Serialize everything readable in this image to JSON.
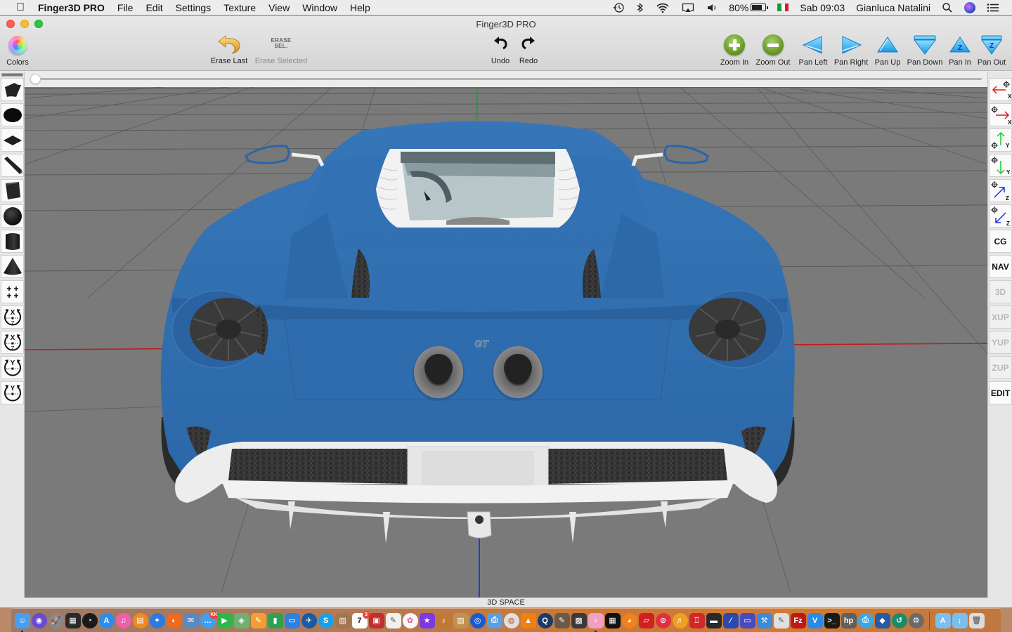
{
  "menubar": {
    "apple_icon": "apple-logo-icon",
    "app_name": "Finger3D PRO",
    "menus": [
      "File",
      "Edit",
      "Settings",
      "Texture",
      "View",
      "Window",
      "Help"
    ],
    "status": {
      "battery_percent": "80%",
      "battery_level": 0.8,
      "datetime": "Sab 09:03",
      "user": "Gianluca Natalini",
      "icons": [
        "time-machine-icon",
        "bluetooth-icon",
        "wifi-icon",
        "airplay-icon",
        "volume-icon",
        "battery-icon",
        "italian-flag-input-icon",
        "spotlight-search-icon",
        "siri-icon",
        "notification-center-icon"
      ]
    }
  },
  "window": {
    "title": "Finger3D PRO",
    "toolbar": {
      "colors": "Colors",
      "erase_last": "Erase Last",
      "erase_selected": "Erase Selected",
      "erase_sel_icon_text_1": "ERASE",
      "erase_sel_icon_text_2": "SEL.",
      "undo": "Undo",
      "redo": "Redo",
      "zoom_in": "Zoom In",
      "zoom_out": "Zoom Out",
      "pan_left": "Pan Left",
      "pan_right": "Pan Right",
      "pan_up": "Pan Up",
      "pan_down": "Pan Down",
      "pan_in": "Pan In",
      "pan_out": "Pan Out",
      "pan_in_letter": "Z",
      "pan_out_letter": "Z"
    },
    "slider_value": 0,
    "left_tools": [
      {
        "name": "curved-surface-tool",
        "icon": "curved-surface-icon"
      },
      {
        "name": "ellipse-disc-tool",
        "icon": "ellipse-icon"
      },
      {
        "name": "plane-tool",
        "icon": "plane-icon"
      },
      {
        "name": "wedge-tool",
        "icon": "wedge-icon"
      },
      {
        "name": "cube-tool",
        "icon": "cube-icon"
      },
      {
        "name": "sphere-tool",
        "icon": "sphere-icon"
      },
      {
        "name": "cylinder-tool",
        "icon": "cylinder-icon"
      },
      {
        "name": "cone-tool",
        "icon": "cone-icon"
      },
      {
        "name": "multi-add-tool",
        "icon": "plus-grid-icon"
      },
      {
        "name": "rotate-xz-cw-tool",
        "icon": "rotate-xz-icon",
        "top": "X",
        "bottom": "Z"
      },
      {
        "name": "rotate-xz-ccw-tool",
        "icon": "rotate-xz-icon",
        "top": "X",
        "bottom": "Z"
      },
      {
        "name": "rotate-y-cw-tool",
        "icon": "rotate-y-icon",
        "top": "Y",
        "bottom": ""
      },
      {
        "name": "rotate-y-ccw-tool",
        "icon": "rotate-y-icon",
        "top": "Y",
        "bottom": ""
      }
    ],
    "right_tools": {
      "move_x_neg": "X",
      "move_x_pos": "X",
      "move_y_pos": "Y",
      "move_y_neg": "Y",
      "move_z_pos": "Z",
      "move_z_neg": "Z",
      "cg": "CG",
      "nav": "NAV",
      "mode_3d": "3D",
      "xup": "XUP",
      "yup": "YUP",
      "zup": "ZUP",
      "edit": "EDIT"
    },
    "viewport": {
      "background": "#7a7a7a",
      "model_color": "#2f6fb0",
      "axis_colors": {
        "x": "#cc1f1f",
        "y": "#1fa12f",
        "z": "#1f3fcc"
      },
      "badge_text": "GT"
    },
    "status_label": "3D SPACE"
  },
  "dock": {
    "apps": [
      {
        "name": "finder",
        "color": "#4a9ef0",
        "glyph": "☺",
        "running": true
      },
      {
        "name": "siri",
        "color": "#6a4ad0",
        "glyph": "◉",
        "round": true
      },
      {
        "name": "launchpad",
        "color": "#888",
        "glyph": "🚀",
        "round": true
      },
      {
        "name": "mission-control",
        "color": "#2a2a2a",
        "glyph": "▦"
      },
      {
        "name": "dashboard",
        "color": "#1a1a1a",
        "glyph": "◔",
        "round": true
      },
      {
        "name": "app-store",
        "color": "#2a8ef0",
        "glyph": "A",
        "round": true
      },
      {
        "name": "itunes",
        "color": "#f060a8",
        "glyph": "♫",
        "round": true
      },
      {
        "name": "ibooks",
        "color": "#f08a20",
        "glyph": "▤",
        "round": true
      },
      {
        "name": "safari",
        "color": "#2a7ae0",
        "glyph": "✦",
        "round": true
      },
      {
        "name": "firefox",
        "color": "#f06a1a",
        "glyph": "◐",
        "round": true
      },
      {
        "name": "mail",
        "color": "#5a88c0",
        "glyph": "✉"
      },
      {
        "name": "messages",
        "color": "#3aa0f8",
        "glyph": "…",
        "round": true,
        "badge": "KK"
      },
      {
        "name": "facetime",
        "color": "#2ab84a",
        "glyph": "▶"
      },
      {
        "name": "maps",
        "color": "#70b070",
        "glyph": "◈"
      },
      {
        "name": "pages",
        "color": "#f0a030",
        "glyph": "✎"
      },
      {
        "name": "numbers",
        "color": "#30a050",
        "glyph": "▮"
      },
      {
        "name": "keynote",
        "color": "#3080e0",
        "glyph": "▭"
      },
      {
        "name": "openoffice",
        "color": "#1a5aa0",
        "glyph": "✈",
        "round": true
      },
      {
        "name": "skype",
        "color": "#1aa0e8",
        "glyph": "S",
        "round": true
      },
      {
        "name": "contacts",
        "color": "#a07850",
        "glyph": "▥"
      },
      {
        "name": "calendar",
        "color": "#ffffff",
        "glyph": "7",
        "text_color": "#222",
        "badge": "3"
      },
      {
        "name": "photo-booth",
        "color": "#c03030",
        "glyph": "▣"
      },
      {
        "name": "textedit",
        "color": "#f0f0f0",
        "glyph": "✎",
        "text_color": "#555"
      },
      {
        "name": "photos",
        "color": "#f8f8f8",
        "glyph": "✿",
        "text_color": "#e05a8a",
        "round": true
      },
      {
        "name": "imovie",
        "color": "#7a3ae0",
        "glyph": "★"
      },
      {
        "name": "garageband",
        "color": "#c07a30",
        "glyph": "♪"
      },
      {
        "name": "preview",
        "color": "#c09050",
        "glyph": "▧"
      },
      {
        "name": "dvd-player",
        "color": "#1a5ad0",
        "glyph": "◎",
        "round": true
      },
      {
        "name": "printer-app",
        "color": "#5aa0e0",
        "glyph": "⎙"
      },
      {
        "name": "disk-utility",
        "color": "#e0e0e0",
        "glyph": "◍",
        "text_color": "#c05030",
        "round": true
      },
      {
        "name": "vlc",
        "color": "#f08010",
        "glyph": "▲"
      },
      {
        "name": "quicktime",
        "color": "#1a3a6a",
        "glyph": "Q",
        "round": true
      },
      {
        "name": "gimp",
        "color": "#6a5a4a",
        "glyph": "✎"
      },
      {
        "name": "scanner-app",
        "color": "#3a3a3a",
        "glyph": "▩"
      },
      {
        "name": "image-app",
        "color": "#f0a0c0",
        "glyph": "♀",
        "running": true
      },
      {
        "name": "film-app",
        "color": "#111",
        "glyph": "▦"
      },
      {
        "name": "blender",
        "color": "#f08020",
        "glyph": "◕",
        "round": true
      },
      {
        "name": "sketchup",
        "color": "#d02020",
        "glyph": "▱"
      },
      {
        "name": "record-app",
        "color": "#e03040",
        "glyph": "⊙",
        "round": true
      },
      {
        "name": "audacity",
        "color": "#f0a020",
        "glyph": "♬",
        "round": true
      },
      {
        "name": "joystick-app",
        "color": "#d02828",
        "glyph": "♖"
      },
      {
        "name": "remote-app",
        "color": "#2a2a2a",
        "glyph": "▬"
      },
      {
        "name": "aegisub",
        "color": "#2a4ab0",
        "glyph": "∕"
      },
      {
        "name": "screen-app",
        "color": "#4a4ac0",
        "glyph": "▭"
      },
      {
        "name": "xcode",
        "color": "#3a8ae0",
        "glyph": "⚒"
      },
      {
        "name": "script-editor",
        "color": "#e0e0e0",
        "glyph": "✎",
        "text_color": "#555"
      },
      {
        "name": "filezilla",
        "color": "#c01818",
        "glyph": "Fz"
      },
      {
        "name": "vs-code",
        "color": "#2a8ae8",
        "glyph": "V"
      },
      {
        "name": "terminal",
        "color": "#1a1a1a",
        "glyph": ">_"
      },
      {
        "name": "hp-scanner",
        "color": "#606060",
        "glyph": "hp"
      },
      {
        "name": "hp-easy-start",
        "color": "#3aa8e8",
        "glyph": "⎙",
        "round": true
      },
      {
        "name": "virtualbox",
        "color": "#2a5aa0",
        "glyph": "◆"
      },
      {
        "name": "time-machine",
        "color": "#1a8a6a",
        "glyph": "↺",
        "round": true
      },
      {
        "name": "system-preferences",
        "color": "#6a6a6a",
        "glyph": "⚙",
        "round": true
      }
    ],
    "folders": [
      {
        "name": "applications-folder",
        "color": "#7ac0ee",
        "glyph": "A"
      },
      {
        "name": "downloads-folder",
        "color": "#7ac0ee",
        "glyph": "↓"
      },
      {
        "name": "trash",
        "color": "#dcdcdc",
        "glyph": "🗑",
        "text_color": "#777"
      }
    ]
  }
}
